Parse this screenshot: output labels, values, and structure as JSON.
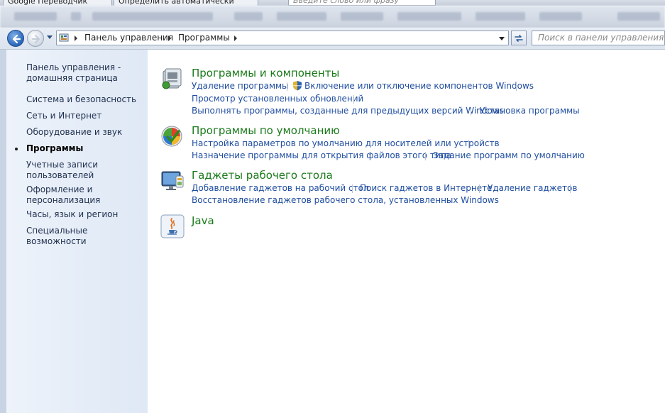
{
  "browser": {
    "tabs": [
      "Google Переводчик",
      "Определить автоматически"
    ],
    "search_placeholder": "Введите слово или фразу"
  },
  "nav": {
    "breadcrumbs": [
      "Панель управления",
      "Программы"
    ],
    "search_placeholder": "Поиск в панели управления",
    "icons": [
      "back-arrow-icon",
      "forward-arrow-icon",
      "control-panel-icon",
      "refresh-icon"
    ]
  },
  "sidebar": {
    "items": [
      {
        "label": "Панель управления - домашняя страница",
        "active": false
      },
      {
        "label": "Система и безопасность",
        "active": false
      },
      {
        "label": "Сеть и Интернет",
        "active": false
      },
      {
        "label": "Оборудование и звук",
        "active": false
      },
      {
        "label": "Программы",
        "active": true
      },
      {
        "label": "Учетные записи пользователей",
        "active": false
      },
      {
        "label": "Оформление и персонализация",
        "active": false
      },
      {
        "label": "Часы, язык и регион",
        "active": false
      },
      {
        "label": "Специальные возможности",
        "active": false
      }
    ]
  },
  "categories": [
    {
      "title": "Программы и компоненты",
      "icon": "programs-features-icon",
      "links": [
        [
          "Удаление программы",
          "Включение или отключение компонентов Windows"
        ],
        [
          "Просмотр установленных обновлений"
        ],
        [
          "Выполнять программы, созданные для предыдущих версий Windows",
          "Установка программы"
        ]
      ]
    },
    {
      "title": "Программы по умолчанию",
      "icon": "default-programs-icon",
      "links": [
        [
          "Настройка параметров по умолчанию для носителей или устройств"
        ],
        [
          "Назначение программы для открытия файлов этого типа",
          "Задание программ по умолчанию"
        ]
      ]
    },
    {
      "title": "Гаджеты рабочего стола",
      "icon": "desktop-gadgets-icon",
      "links": [
        [
          "Добавление гаджетов на рабочий стол",
          "Поиск гаджетов в Интернете",
          "Удаление гаджетов"
        ],
        [
          "Восстановление гаджетов рабочего стола, установленных Windows"
        ]
      ]
    },
    {
      "title": "Java",
      "icon": "java-icon",
      "links": []
    }
  ]
}
